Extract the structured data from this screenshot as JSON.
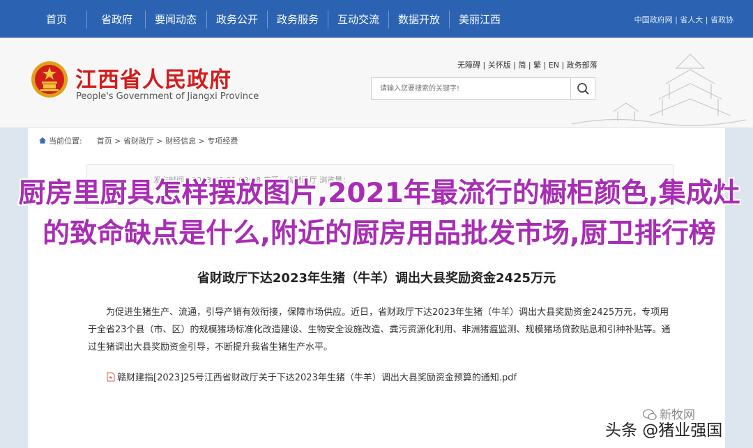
{
  "top_nav": {
    "items": [
      "首页",
      "省政府",
      "要闻动态",
      "政务公开",
      "政务服务",
      "互动交流",
      "数据开放",
      "美丽江西"
    ],
    "right_links": "中国政府网 | 省人大 | 省政协"
  },
  "header": {
    "title": "江西省人民政府",
    "subtitle": "People's Government of Jiangxi Province",
    "utility_links": "无障碍 | 关怀版 | 简 | 繁 | EN | 政务部落",
    "search_placeholder": "请输入您要搜索的关键字!"
  },
  "breadcrumb": {
    "label": "当前位置:",
    "path": "首页 > 省财政厅 > 财经信息 > 专项经费"
  },
  "article": {
    "meta": "发布时间：2023-09-21 08:48 来源：省财政厅 浏览量：",
    "title": "省财政厅下达2023年生猪（牛羊）调出大县奖励资金2425万元",
    "body": "为促进生猪生产、流通，引导产销有效衔接，保障市场供应。近日，省财政厅下达2023年生猪（牛羊）调出大县奖励资金2425万元，专项用于全省23个县（市、区）的规模猪场标准化改造建设、生物安全设施改造、粪污资源化利用、非洲猪瘟监测、规模猪场贷款贴息和引种补贴等。通过生猪调出大县奖励资金引导，不断提升我省生猪生产水平。",
    "attachment": "赣财建指[2023]25号江西省财政厅关于下达2023年生猪（牛羊）调出大县奖励资金预算的通知.pdf"
  },
  "overlay_title": "厨房里厨具怎样摆放图片,2021年最流行的橱柜颜色,集成灶的致命缺点是什么,附近的厨房用品批发市场,厨卫排行榜",
  "watermarks": {
    "small": "新牧网",
    "big": "头条 @猪业强国"
  },
  "colors": {
    "nav_bg": "#2b63b2",
    "title_red": "#d21c1c",
    "overlay_purple": "#a82db4"
  }
}
